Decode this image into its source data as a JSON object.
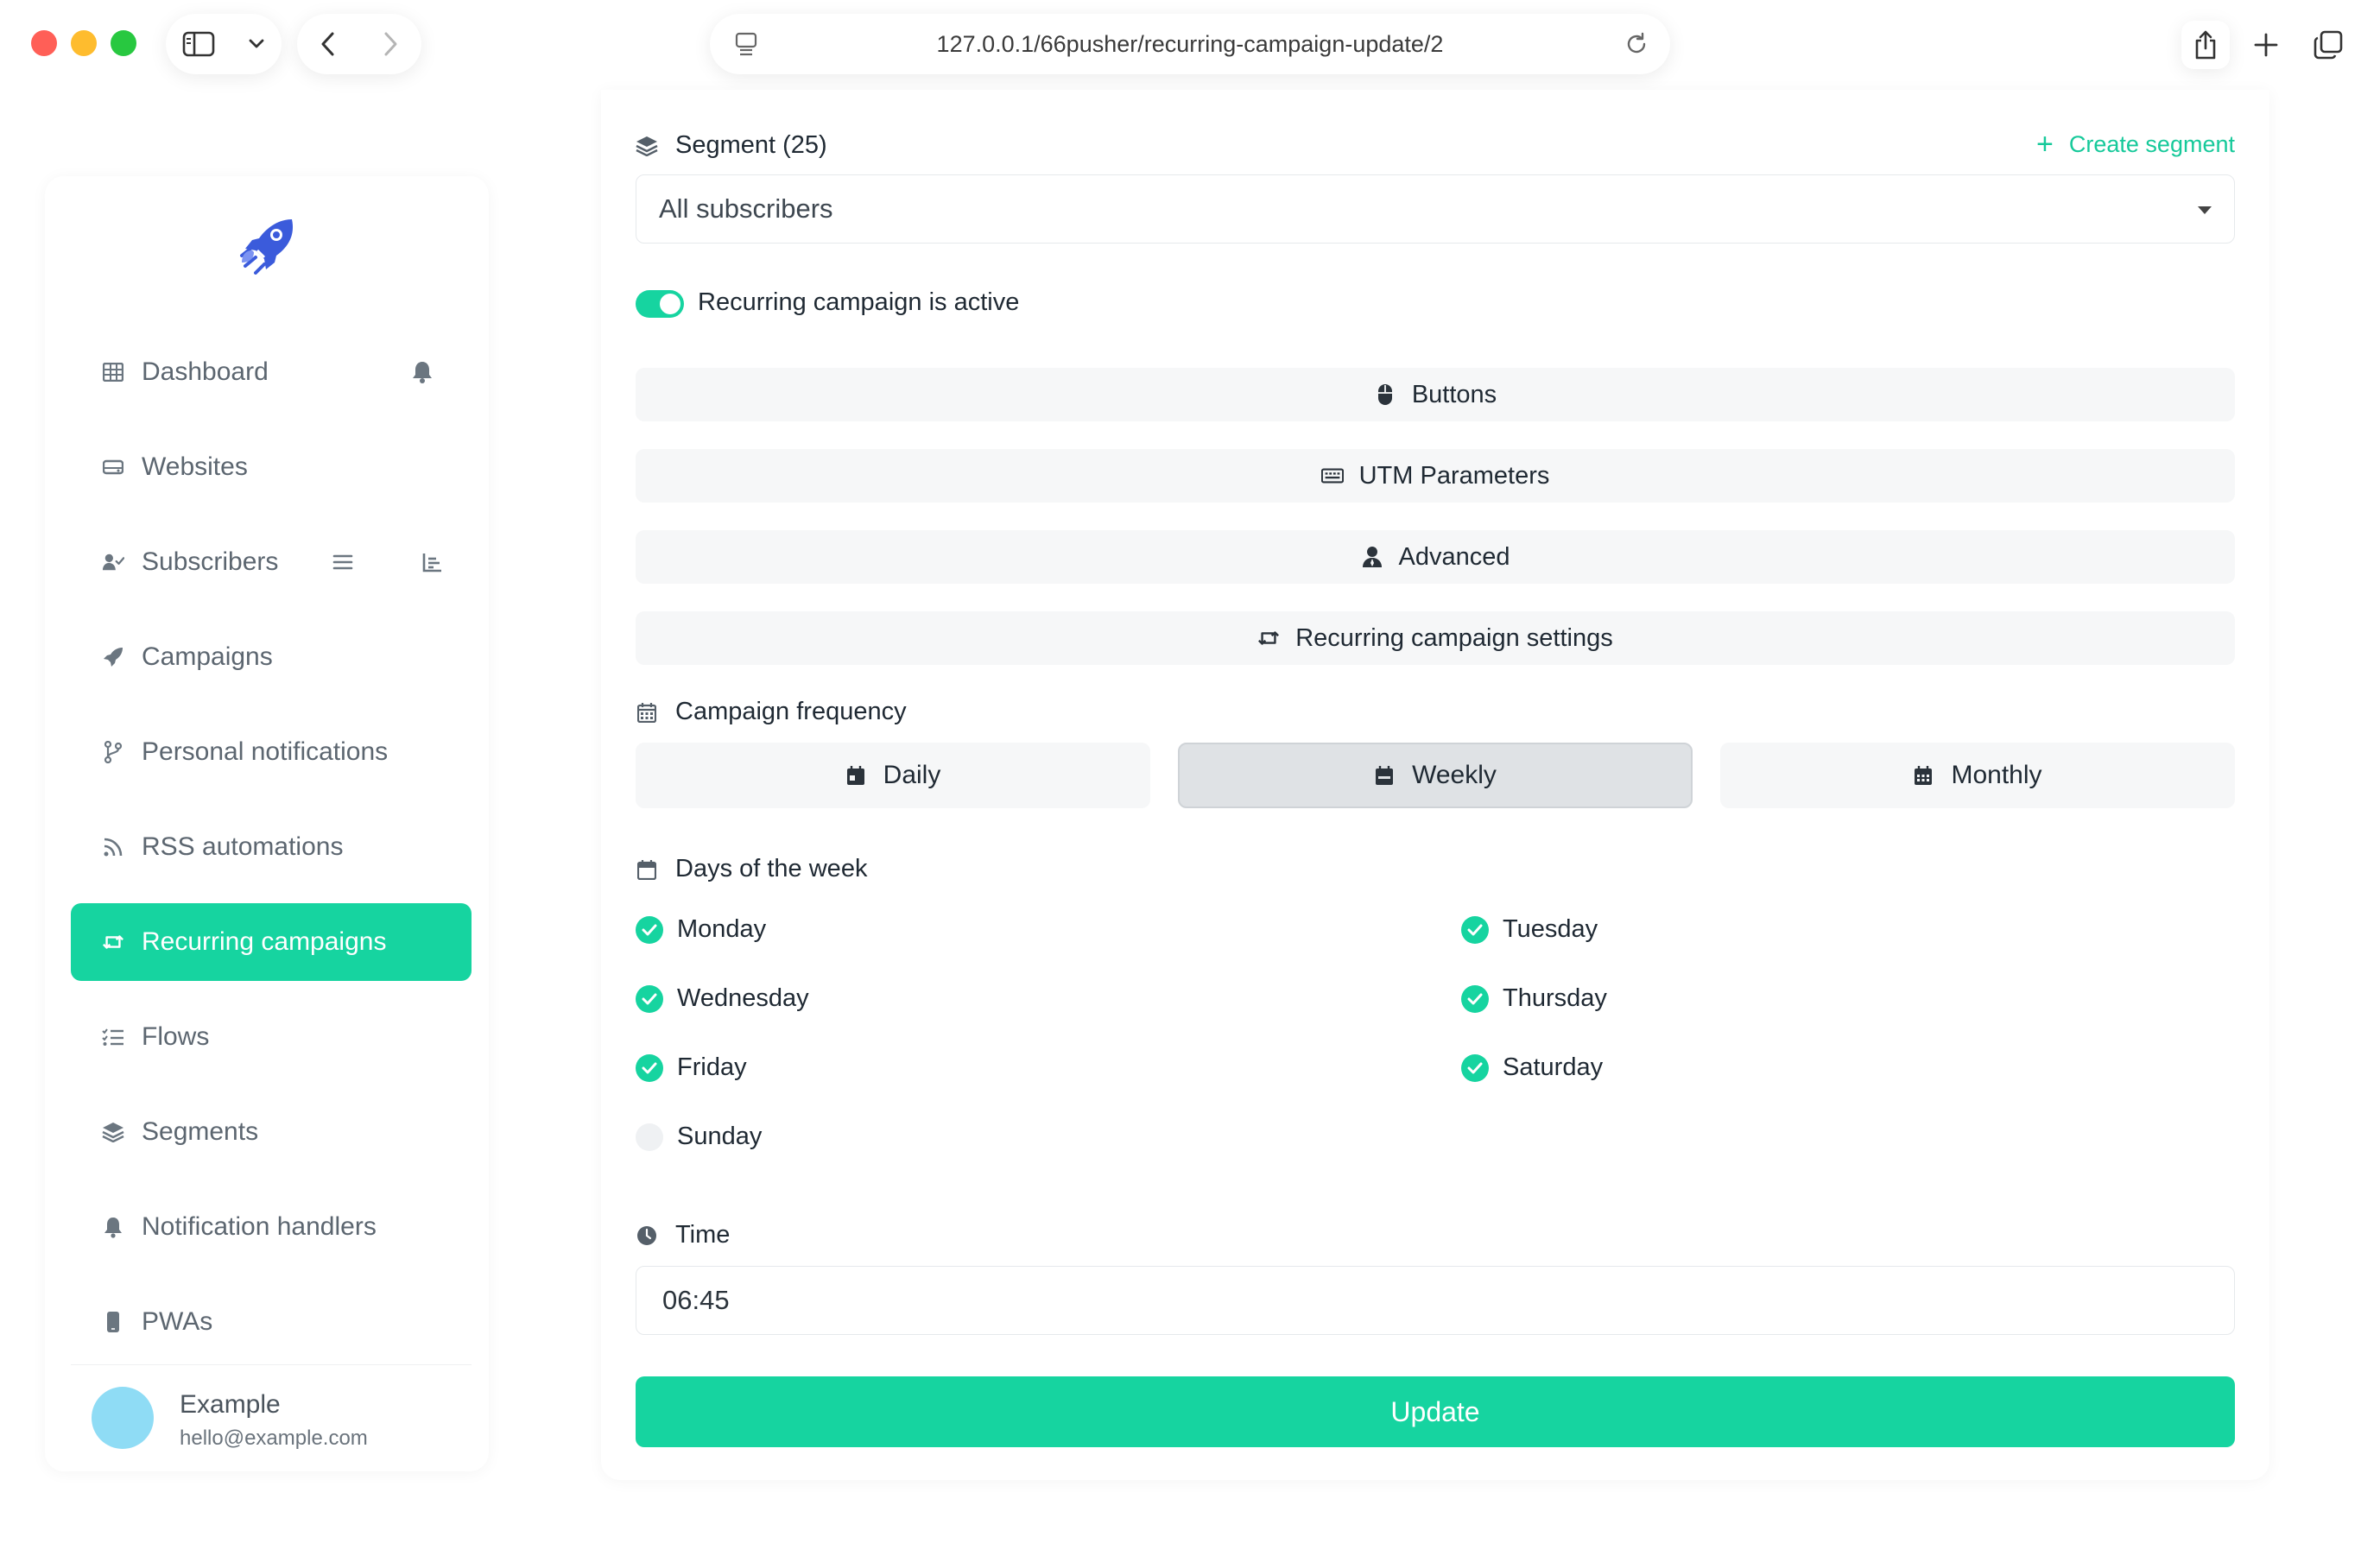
{
  "browser": {
    "url": "127.0.0.1/66pusher/recurring-campaign-update/2"
  },
  "sidebar": {
    "items": [
      {
        "label": "Dashboard",
        "icon": "table-icon"
      },
      {
        "label": "Websites",
        "icon": "hdd-icon"
      },
      {
        "label": "Subscribers",
        "icon": "user-check-icon"
      },
      {
        "label": "Campaigns",
        "icon": "rocket-icon"
      },
      {
        "label": "Personal notifications",
        "icon": "code-branch-icon"
      },
      {
        "label": "RSS automations",
        "icon": "rss-icon"
      },
      {
        "label": "Recurring campaigns",
        "icon": "retweet-icon",
        "active": true
      },
      {
        "label": "Flows",
        "icon": "list-check-icon"
      },
      {
        "label": "Segments",
        "icon": "layer-group-icon"
      },
      {
        "label": "Notification handlers",
        "icon": "bell-icon"
      },
      {
        "label": "PWAs",
        "icon": "mobile-icon"
      }
    ],
    "user": {
      "name": "Example",
      "email": "hello@example.com"
    }
  },
  "form": {
    "segment_label": "Segment (25)",
    "create_segment": "Create segment",
    "segment_value": "All subscribers",
    "active_toggle_label": "Recurring campaign is active",
    "active": true,
    "sections": {
      "buttons": "Buttons",
      "utm": "UTM Parameters",
      "advanced": "Advanced",
      "recurring": "Recurring campaign settings"
    },
    "frequency_label": "Campaign frequency",
    "frequency_options": {
      "daily": "Daily",
      "weekly": "Weekly",
      "monthly": "Monthly"
    },
    "frequency_selected": "Weekly",
    "days_label": "Days of the week",
    "days": {
      "monday": {
        "label": "Monday",
        "checked": true
      },
      "tuesday": {
        "label": "Tuesday",
        "checked": true
      },
      "wednesday": {
        "label": "Wednesday",
        "checked": true
      },
      "thursday": {
        "label": "Thursday",
        "checked": true
      },
      "friday": {
        "label": "Friday",
        "checked": true
      },
      "saturday": {
        "label": "Saturday",
        "checked": true
      },
      "sunday": {
        "label": "Sunday",
        "checked": false
      }
    },
    "time_label": "Time",
    "time_value": "06:45",
    "submit_label": "Update"
  },
  "colors": {
    "accent": "#16d4a0",
    "accent_text": "#16c99a",
    "selected_button": "#dfe2e5"
  }
}
